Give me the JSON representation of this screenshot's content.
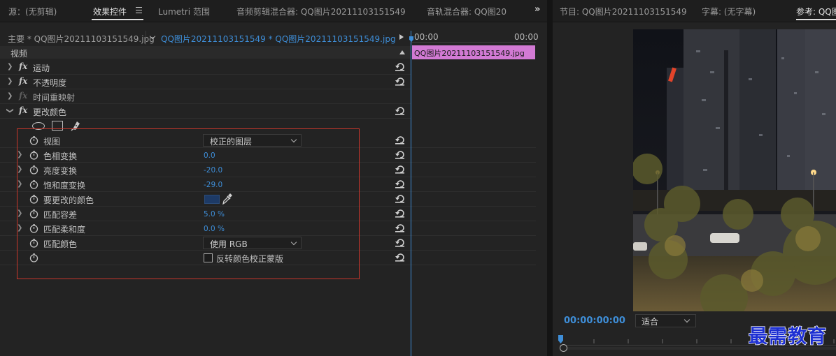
{
  "left_tabs": {
    "source": "源：(无剪辑)",
    "effect_controls": "效果控件",
    "lumetri": "Lumetri 范围",
    "audio_clip_mixer": "音频剪辑混合器: QQ图片20211103151549",
    "audio_track_mixer": "音轨混合器: QQ图20"
  },
  "sequence": {
    "master": "主要 * QQ图片20211103151549.jpg",
    "clip": "QQ图片20211103151549 * QQ图片20211103151549.jpg"
  },
  "section": {
    "video": "视频"
  },
  "effects": [
    {
      "name": "运动",
      "enabled": true
    },
    {
      "name": "不透明度",
      "enabled": true
    },
    {
      "name": "时间重映射",
      "enabled": false
    },
    {
      "name": "更改颜色",
      "enabled": true,
      "expanded": true
    }
  ],
  "params": {
    "view": {
      "name": "视图",
      "value": "校正的图层"
    },
    "hue": {
      "name": "色相变换",
      "value": "0.0"
    },
    "lightness": {
      "name": "亮度变换",
      "value": "-20.0"
    },
    "saturation": {
      "name": "饱和度变换",
      "value": "-29.0"
    },
    "color_to_change": {
      "name": "要更改的颜色",
      "swatch": "#1d3a66"
    },
    "tolerance": {
      "name": "匹配容差",
      "value": "5.0 %"
    },
    "softness": {
      "name": "匹配柔和度",
      "value": "0.0 %"
    },
    "match_colors": {
      "name": "匹配颜色",
      "value": "使用 RGB"
    },
    "invert": {
      "label": "反转颜色校正蒙版",
      "checked": false
    }
  },
  "timeline": {
    "start": "00:00",
    "end": "00:00",
    "clip_label": "QQ图片20211103151549.jpg",
    "clip_color": "#d27ad4"
  },
  "right_tabs": {
    "program": "节目: QQ图片20211103151549",
    "captions": "字幕: (无字幕)",
    "reference": "参考: QQ图"
  },
  "viewer": {
    "timecode": "00:00:00:00",
    "fit": "适合"
  },
  "watermark": "最需教育",
  "colors": {
    "accent": "#3e8ed8",
    "highlight_box": "#c9372c",
    "clip": "#d27ad4"
  },
  "icons": [
    "fx-icon",
    "reset-icon",
    "stopwatch-icon",
    "eyedropper-icon",
    "ellipse-mask-icon",
    "rectangle-mask-icon",
    "pen-mask-icon",
    "menu-icon"
  ]
}
